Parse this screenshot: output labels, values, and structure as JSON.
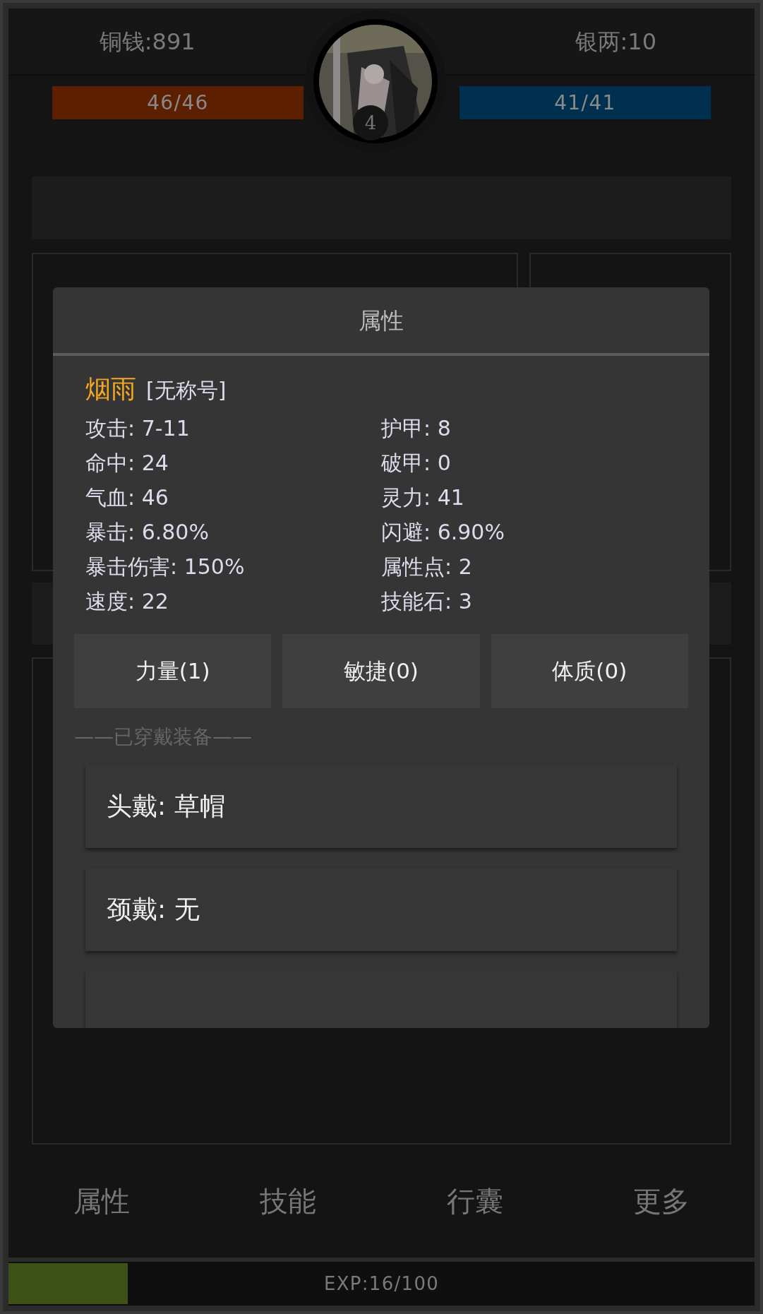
{
  "currency": [
    {
      "label": "铜钱:891"
    },
    {
      "label": "银两:10"
    }
  ],
  "hp": {
    "reading": "46/46",
    "level": 1
  },
  "mp": {
    "reading": "41/41",
    "level": 1
  },
  "avatar": {
    "level_badge": "4"
  },
  "dialog": {
    "title": "属性",
    "name": "烟雨",
    "title_tag": "[无称号]",
    "stats": [
      {
        "label": "攻击:",
        "value": "7-11"
      },
      {
        "label": "护甲:",
        "value": "8"
      },
      {
        "label": "命中:",
        "value": "24"
      },
      {
        "label": "破甲:",
        "value": "0"
      },
      {
        "label": "气血:",
        "value": "46"
      },
      {
        "label": "灵力:",
        "value": "41"
      },
      {
        "label": "暴击:",
        "value": "6.80%"
      },
      {
        "label": "闪避:",
        "value": "6.90%"
      },
      {
        "label": "暴击伤害:",
        "value": "150%"
      },
      {
        "label": "属性点:",
        "value": "2"
      },
      {
        "label": "速度:",
        "value": "22"
      },
      {
        "label": "技能石:",
        "value": "3"
      }
    ],
    "buttons": [
      "力量(1)",
      "敏捷(0)",
      "体质(0)"
    ],
    "equipment_heading": "——已穿戴装备——",
    "equipment": [
      {
        "slot": "头戴:",
        "item": "草帽"
      },
      {
        "slot": "颈戴:",
        "item": "无"
      }
    ]
  },
  "nav_tabs": [
    {
      "label": "属性"
    },
    {
      "label": "技能"
    },
    {
      "label": "行囊"
    },
    {
      "label": "更多"
    }
  ],
  "exp": {
    "reading": "EXP:16/100",
    "level": 0.16
  }
}
